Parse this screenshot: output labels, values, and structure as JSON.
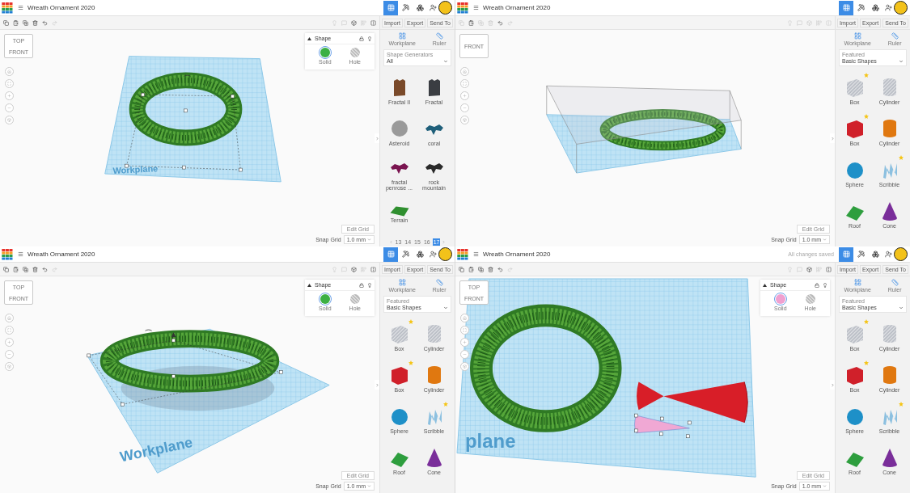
{
  "panes": [
    {
      "title": "Wreath Ornament 2020",
      "view_modes": [
        {
          "kind": "grid",
          "selected": true
        },
        {
          "kind": "build",
          "selected": false
        },
        {
          "kind": "bricks",
          "selected": false
        }
      ],
      "edit_tools_enabled": true,
      "panel_buttons": [
        "Import",
        "Export",
        "Send To"
      ],
      "scene": {
        "kind": "wreath-selected"
      },
      "workplane_label": "Workplane",
      "viewcube": {
        "top": "TOP",
        "front": "FRONT"
      },
      "shape_panel": {
        "title": "Shape",
        "options": [
          {
            "label": "Solid",
            "kind": "solid",
            "selected": true,
            "color": "#3cb043"
          },
          {
            "label": "Hole",
            "kind": "hole",
            "selected": false
          }
        ]
      },
      "library": {
        "tools": [
          "Workplane",
          "Ruler"
        ],
        "category_label": "Shape Generators",
        "category_value": "All",
        "shapes": [
          {
            "label": "Fractal II",
            "kind": "column",
            "color": "#7a4a2a",
            "striped": false,
            "starred": false
          },
          {
            "label": "Fractal",
            "kind": "column",
            "color": "#3a3d42",
            "striped": false,
            "starred": false
          },
          {
            "label": "Asteroid",
            "kind": "ball",
            "color": "#9a9a9a",
            "striped": false,
            "starred": false
          },
          {
            "label": "coral",
            "kind": "blob",
            "color": "#1f5f7a",
            "striped": false,
            "starred": false
          },
          {
            "label": "fractal penrose ...",
            "kind": "blob",
            "color": "#7a1450",
            "striped": false,
            "starred": false
          },
          {
            "label": "rock mountain",
            "kind": "blob",
            "color": "#2a2a2a",
            "striped": false,
            "starred": false
          },
          {
            "label": "Terrain",
            "kind": "slab",
            "color": "#2f8f2f",
            "striped": false,
            "starred": false
          }
        ],
        "pages": [
          {
            "label": "13",
            "selected": false
          },
          {
            "label": "14",
            "selected": false
          },
          {
            "label": "15",
            "selected": false
          },
          {
            "label": "16",
            "selected": false
          },
          {
            "label": "17",
            "selected": true
          }
        ]
      },
      "edit_grid": "Edit Grid",
      "snap_grid": {
        "label": "Snap Grid",
        "value": "1.0 mm"
      }
    },
    {
      "title": "Wreath Ornament 2020",
      "view_modes": [
        {
          "kind": "grid",
          "selected": true
        },
        {
          "kind": "build",
          "selected": false
        },
        {
          "kind": "bricks",
          "selected": false
        }
      ],
      "edit_tools_enabled": false,
      "panel_buttons": [
        "Import",
        "Export",
        "Send To"
      ],
      "scene": {
        "kind": "wreath-box"
      },
      "viewcube": {
        "front": "FRONT"
      },
      "library": {
        "tools": [
          "Workplane",
          "Ruler"
        ],
        "category_label": "Featured",
        "category_value": "Basic Shapes",
        "shapes": [
          {
            "label": "Box",
            "kind": "box",
            "color": "#b8bcc4",
            "striped": true,
            "starred": true
          },
          {
            "label": "Cylinder",
            "kind": "cylinder",
            "color": "#b8bcc4",
            "striped": true,
            "starred": false
          },
          {
            "label": "Box",
            "kind": "box",
            "color": "#d0202a",
            "striped": false,
            "starred": true
          },
          {
            "label": "Cylinder",
            "kind": "cylinder",
            "color": "#e07810",
            "striped": false,
            "starred": false
          },
          {
            "label": "Sphere",
            "kind": "sphere",
            "color": "#1e90c8",
            "striped": false,
            "starred": false
          },
          {
            "label": "Scribble",
            "kind": "scribble",
            "color": "#8cc0e0",
            "striped": false,
            "starred": true
          },
          {
            "label": "Roof",
            "kind": "roof",
            "color": "#2e9e3e",
            "striped": false,
            "starred": false
          },
          {
            "label": "Cone",
            "kind": "cone",
            "color": "#7a2e9a",
            "striped": false,
            "starred": false
          }
        ]
      },
      "edit_grid": "Edit Grid",
      "snap_grid": {
        "label": "Snap Grid",
        "value": "1.0 mm"
      }
    },
    {
      "title": "Wreath Ornament 2020",
      "view_modes": [
        {
          "kind": "grid",
          "selected": true
        },
        {
          "kind": "build",
          "selected": false
        },
        {
          "kind": "bricks",
          "selected": false
        }
      ],
      "edit_tools_enabled": true,
      "panel_buttons": [
        "Import",
        "Export",
        "Send To"
      ],
      "scene": {
        "kind": "wreath-tilted"
      },
      "workplane_label": "Workplane",
      "viewcube": {
        "top": "TOP",
        "front": "FRONT"
      },
      "shape_panel": {
        "title": "Shape",
        "options": [
          {
            "label": "Solid",
            "kind": "solid",
            "selected": true,
            "color": "#3cb043"
          },
          {
            "label": "Hole",
            "kind": "hole",
            "selected": false
          }
        ]
      },
      "library": {
        "tools": [
          "Workplane",
          "Ruler"
        ],
        "category_label": "Featured",
        "category_value": "Basic Shapes",
        "shapes": [
          {
            "label": "Box",
            "kind": "box",
            "color": "#b8bcc4",
            "striped": true,
            "starred": true
          },
          {
            "label": "Cylinder",
            "kind": "cylinder",
            "color": "#b8bcc4",
            "striped": true,
            "starred": false
          },
          {
            "label": "Box",
            "kind": "box",
            "color": "#d0202a",
            "striped": false,
            "starred": true
          },
          {
            "label": "Cylinder",
            "kind": "cylinder",
            "color": "#e07810",
            "striped": false,
            "starred": false
          },
          {
            "label": "Sphere",
            "kind": "sphere",
            "color": "#1e90c8",
            "striped": false,
            "starred": false
          },
          {
            "label": "Scribble",
            "kind": "scribble",
            "color": "#8cc0e0",
            "striped": false,
            "starred": true
          },
          {
            "label": "Roof",
            "kind": "roof",
            "color": "#2e9e3e",
            "striped": false,
            "starred": false
          },
          {
            "label": "Cone",
            "kind": "cone",
            "color": "#7a2e9a",
            "striped": false,
            "starred": false
          }
        ]
      },
      "edit_grid": "Edit Grid",
      "snap_grid": {
        "label": "Snap Grid",
        "value": "1.0 mm"
      }
    },
    {
      "title": "Wreath Ornament 2020",
      "status": "All changes saved",
      "view_modes": [
        {
          "kind": "grid",
          "selected": true
        },
        {
          "kind": "build",
          "selected": false
        },
        {
          "kind": "bricks",
          "selected": false
        }
      ],
      "edit_tools_enabled": true,
      "panel_buttons": [
        "Import",
        "Export",
        "Send To"
      ],
      "scene": {
        "kind": "wreath-bow"
      },
      "workplane_label": "plane",
      "viewcube": {
        "top": "TOP",
        "front": "FRONT"
      },
      "shape_panel": {
        "title": "Shape",
        "options": [
          {
            "label": "Solid",
            "kind": "solid",
            "selected": true,
            "color": "#f0a0d0"
          },
          {
            "label": "Hole",
            "kind": "hole",
            "selected": false
          }
        ]
      },
      "library": {
        "tools": [
          "Workplane",
          "Ruler"
        ],
        "category_label": "Featured",
        "category_value": "Basic Shapes",
        "shapes": [
          {
            "label": "Box",
            "kind": "box",
            "color": "#b8bcc4",
            "striped": true,
            "starred": true
          },
          {
            "label": "Cylinder",
            "kind": "cylinder",
            "color": "#b8bcc4",
            "striped": true,
            "starred": false
          },
          {
            "label": "Box",
            "kind": "box",
            "color": "#d0202a",
            "striped": false,
            "starred": true
          },
          {
            "label": "Cylinder",
            "kind": "cylinder",
            "color": "#e07810",
            "striped": false,
            "starred": false
          },
          {
            "label": "Sphere",
            "kind": "sphere",
            "color": "#1e90c8",
            "striped": false,
            "starred": false
          },
          {
            "label": "Scribble",
            "kind": "scribble",
            "color": "#8cc0e0",
            "striped": false,
            "starred": true
          },
          {
            "label": "Roof",
            "kind": "roof",
            "color": "#2e9e3e",
            "striped": false,
            "starred": false
          },
          {
            "label": "Cone",
            "kind": "cone",
            "color": "#7a2e9a",
            "striped": false,
            "starred": false
          }
        ]
      },
      "edit_grid": "Edit Grid",
      "snap_grid": {
        "label": "Snap Grid",
        "value": "1.0 mm"
      }
    }
  ]
}
